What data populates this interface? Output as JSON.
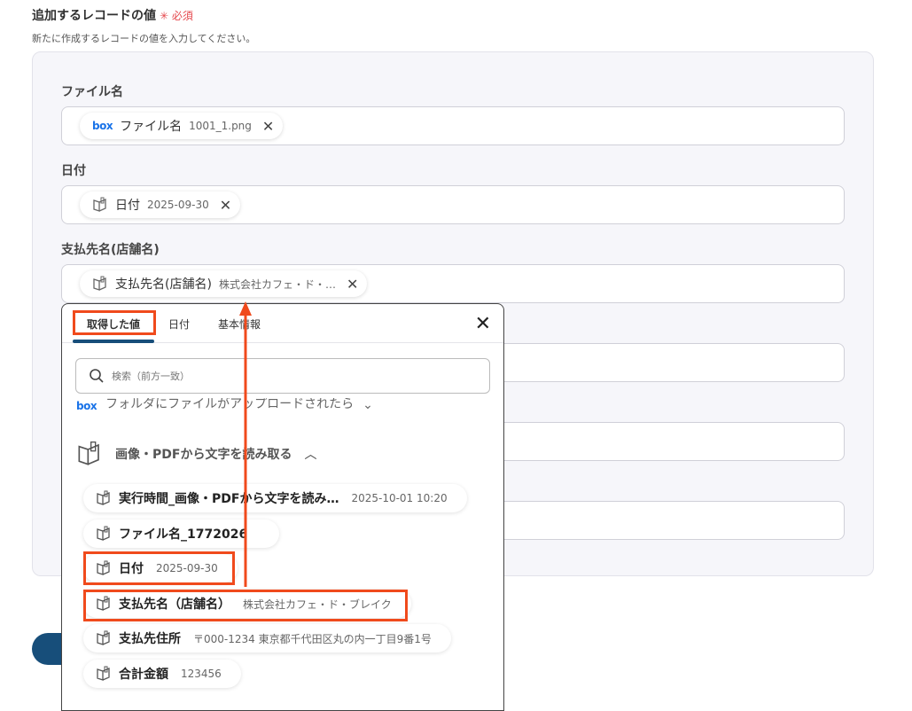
{
  "section": {
    "title": "追加するレコードの値",
    "required": "✳ 必須",
    "description": "新たに作成するレコードの値を入力してください。"
  },
  "fields": [
    {
      "label": "ファイル名",
      "chip_name": "ファイル名",
      "chip_value": "1001_1.png",
      "source": "box"
    },
    {
      "label": "日付",
      "chip_name": "日付",
      "chip_value": "2025-09-30",
      "source": "ocr"
    },
    {
      "label": "支払先名(店舗名)",
      "chip_name": "支払先名(店舗名)",
      "chip_value": "株式会社カフェ・ド・…",
      "source": "ocr"
    }
  ],
  "dropdown": {
    "tabs": [
      "取得した値",
      "日付",
      "基本情報"
    ],
    "active_tab": "取得した値",
    "search_placeholder": "検索（前方一致）",
    "faded_group": "フォルダにファイルがアップロードされたら",
    "group_title": "画像・PDFから文字を読み取る",
    "items": [
      {
        "name": "実行時間_画像・PDFから文字を読み…",
        "value": "2025-10-01 10:20"
      },
      {
        "name": "ファイル名_1772026",
        "value": ""
      },
      {
        "name": "日付",
        "value": "2025-09-30"
      },
      {
        "name": "支払先名（店舗名）",
        "value": "株式会社カフェ・ド・ブレイク"
      },
      {
        "name": "支払先住所",
        "value": "〒000-1234 東京都千代田区丸の内一丁目9番1号"
      },
      {
        "name": "合計金額",
        "value": "123456"
      }
    ]
  },
  "colors": {
    "highlight": "#f04a1c",
    "accent": "#174e7a",
    "required": "#e5484d",
    "box_blue": "#1a73e8"
  }
}
